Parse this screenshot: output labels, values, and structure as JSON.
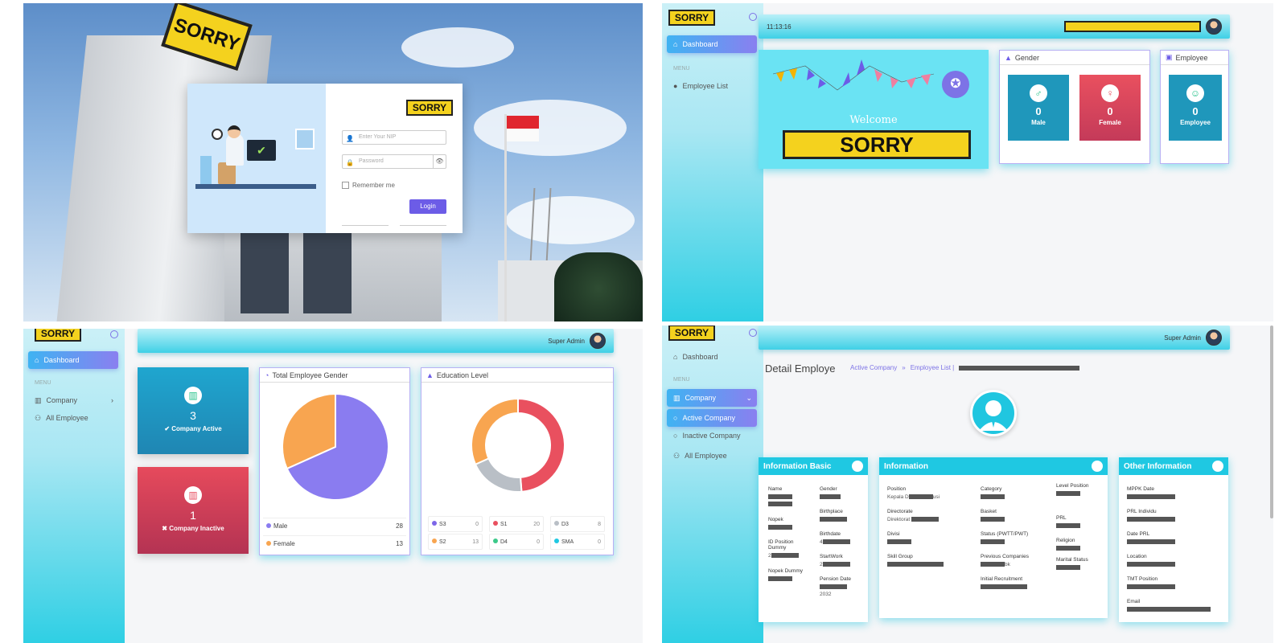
{
  "login": {
    "sign_text": "SORRY",
    "logo_text": "SORRY",
    "nip_placeholder": "Enter Your NIP",
    "password_placeholder": "Password",
    "remember_label": "Remember me",
    "login_label": "Login"
  },
  "dashboard1": {
    "logo_text": "SORRY",
    "nav_dashboard": "Dashboard",
    "menu_label": "MENU",
    "nav_employee_list": "Employee List",
    "time": "11:13:16",
    "welcome_text": "Welcome",
    "welcome_logo": "SORRY",
    "gender_title": "Gender",
    "male_count": "0",
    "male_label": "Male",
    "female_count": "0",
    "female_label": "Female",
    "employee_title": "Employee",
    "employee_count": "0",
    "employee_label": "Employee"
  },
  "dashboard2": {
    "logo_text": "SORRY",
    "nav_dashboard": "Dashboard",
    "menu_label": "MENU",
    "nav_company": "Company",
    "nav_all_employee": "All Employee",
    "user_name": "Super Admin",
    "active_count": "3",
    "active_label": "✔ Company Active",
    "inactive_count": "1",
    "inactive_label": "✖ Company Inactive",
    "gender_chart_title": "Total Employee Gender",
    "education_chart_title": "Education Level"
  },
  "chart_data": [
    {
      "type": "pie",
      "title": "Total Employee Gender",
      "categories": [
        "Male",
        "Female"
      ],
      "values": [
        28,
        13
      ],
      "colors": [
        "#8a7cf0",
        "#f8a550"
      ]
    },
    {
      "type": "pie",
      "title": "Education Level",
      "donut": true,
      "categories": [
        "S3",
        "S1",
        "D3",
        "S2",
        "D4",
        "SMA"
      ],
      "values": [
        0,
        20,
        8,
        13,
        0,
        0
      ],
      "colors": [
        "#7d66e8",
        "#e9505f",
        "#b9bfc6",
        "#f8a550",
        "#3cc98a",
        "#1fc8e2"
      ]
    }
  ],
  "detail": {
    "logo_text": "SORRY",
    "nav_dashboard": "Dashboard",
    "menu_label": "MENU",
    "nav_company": "Company",
    "nav_active_company": "Active Company",
    "nav_inactive_company": "Inactive Company",
    "nav_all_employee": "All Employee",
    "user_name": "Super Admin",
    "page_title": "Detail Employe",
    "crumb_active": "Active Company",
    "crumb_sep": "»",
    "crumb_list": "Employee List |",
    "basic_title": "Information Basic",
    "info_title": "Information",
    "other_title": "Other Information",
    "basic_fields": [
      "Name",
      "Gender",
      "Nopek",
      "Birthplace",
      "ID Position Dummy",
      "Birthdate",
      "StartWork",
      "Nopek Dummy",
      "Pension Date"
    ],
    "birthdate_partial": "4",
    "startwork_partial": "2",
    "id_position_partial": "2",
    "pension_year": "2032",
    "info_fields": [
      "Position",
      "Category",
      "Level Position",
      "Directorate",
      "Basket",
      "PRL",
      "Divisi",
      "Status (PWTT/PWT)",
      "Religion",
      "Skill Group",
      "Previous Companies",
      "Marital Status",
      "Initial Recruitment"
    ],
    "position_partial": "Kepala D",
    "position_suffix": "usi",
    "directorate_partial": "Direktorat",
    "prevcomp_suffix": "bk",
    "other_fields": [
      "MPPK Date",
      "PRL Individu",
      "Date PRL",
      "Location",
      "TMT Position",
      "Email"
    ]
  }
}
